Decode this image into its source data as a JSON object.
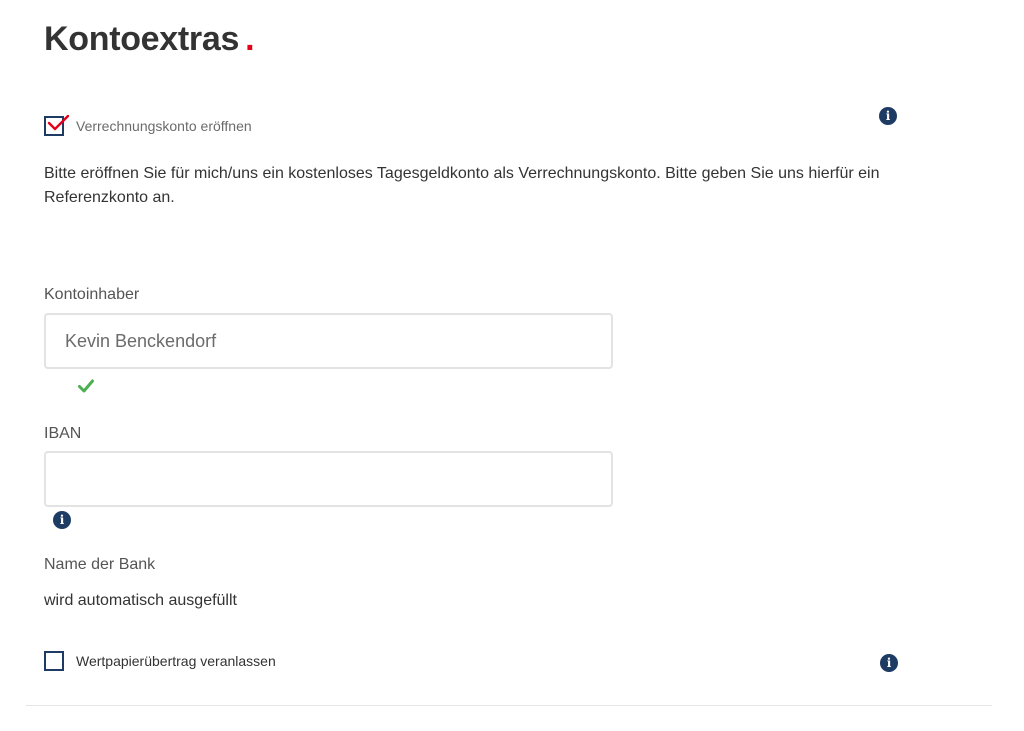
{
  "page": {
    "title": "Kontoextras",
    "title_dot": "."
  },
  "colors": {
    "accent_red": "#e3001b",
    "navy": "#1d3b63",
    "success_green": "#4caf50"
  },
  "verrechnungskonto": {
    "checkbox_label": "Verrechnungskonto eröffnen",
    "checked": true,
    "info_icon": "i",
    "description": "Bitte eröffnen Sie für mich/uns ein kostenloses Tagesgeldkonto als Verrechnungskonto. Bitte geben Sie uns hierfür ein Referenzkonto an."
  },
  "form": {
    "kontoinhaber": {
      "label": "Kontoinhaber",
      "value": "Kevin Benckendorf",
      "valid_icon": "checkmark-icon"
    },
    "iban": {
      "label": "IBAN",
      "value": "",
      "info_icon": "i"
    },
    "bank": {
      "label": "Name der Bank",
      "value": "wird automatisch ausgefüllt"
    }
  },
  "wertpapieruebertrag": {
    "checkbox_label": "Wertpapierübertrag veranlassen",
    "checked": false,
    "info_icon": "i"
  }
}
